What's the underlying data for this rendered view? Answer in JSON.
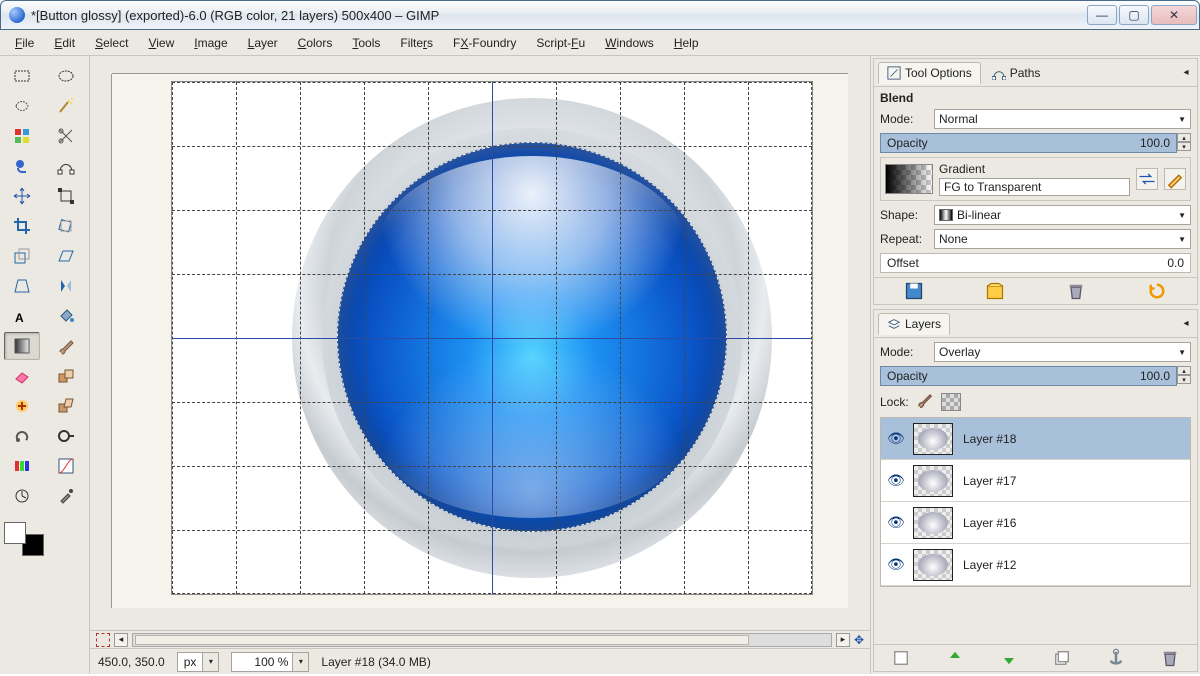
{
  "window": {
    "title": "*[Button glossy] (exported)-6.0 (RGB color, 21 layers) 500x400 – GIMP"
  },
  "menu": [
    "File",
    "Edit",
    "Select",
    "View",
    "Image",
    "Layer",
    "Colors",
    "Tools",
    "Filters",
    "FX-Foundry",
    "Script-Fu",
    "Windows",
    "Help"
  ],
  "status": {
    "coords": "450.0, 350.0",
    "unit": "px",
    "zoom": "100 %",
    "layer_info": "Layer #18 (34.0 MB)"
  },
  "tool_options": {
    "dock_title": "Tool Options",
    "other_tab": "Paths",
    "tool_name": "Blend",
    "mode_label": "Mode:",
    "mode_value": "Normal",
    "opacity_label": "Opacity",
    "opacity_value": "100.0",
    "gradient_label": "Gradient",
    "gradient_value": "FG to Transparent",
    "shape_label": "Shape:",
    "shape_value": "Bi-linear",
    "repeat_label": "Repeat:",
    "repeat_value": "None",
    "offset_label": "Offset",
    "offset_value": "0.0"
  },
  "layers_dock": {
    "dock_title": "Layers",
    "mode_label": "Mode:",
    "mode_value": "Overlay",
    "opacity_label": "Opacity",
    "opacity_value": "100.0",
    "lock_label": "Lock:",
    "items": [
      {
        "name": "Layer #18",
        "selected": true
      },
      {
        "name": "Layer #17",
        "selected": false
      },
      {
        "name": "Layer #16",
        "selected": false
      },
      {
        "name": "Layer #12",
        "selected": false
      }
    ]
  },
  "colors": {
    "guide": "#2b4ba7"
  }
}
